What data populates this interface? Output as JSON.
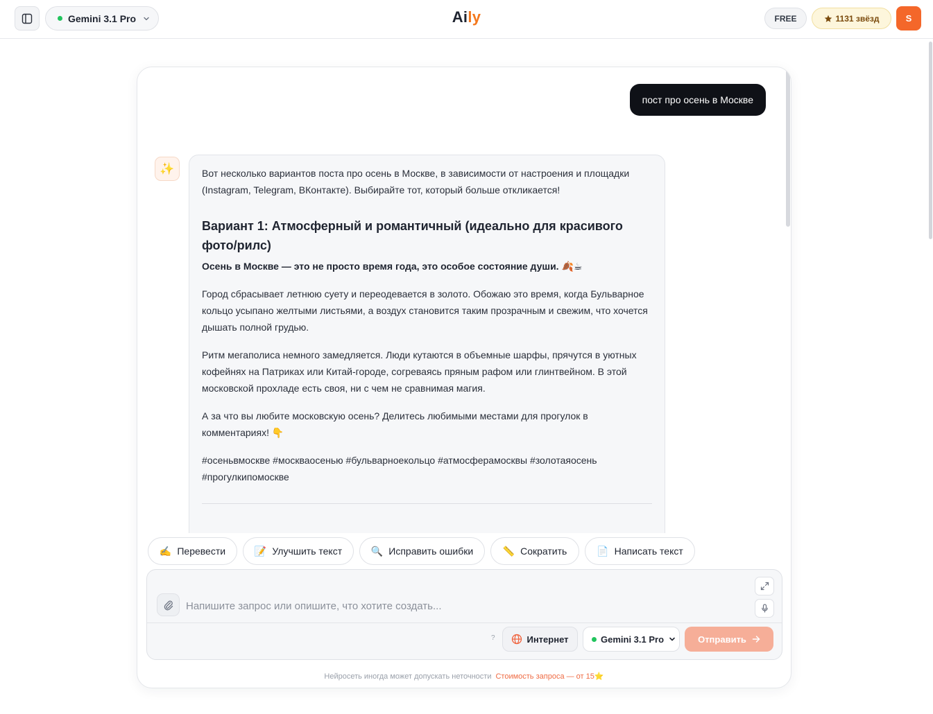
{
  "header": {
    "model_name": "Gemini 3.1 Pro",
    "logo_part1": "Ai",
    "logo_part2": "ly",
    "plan_badge": "FREE",
    "stars_label": "1131 звёзд",
    "avatar_initial": "S",
    "colors": {
      "accent": "#f4781d",
      "avatar": "#f4672a",
      "status_online": "#21c45d"
    }
  },
  "chat": {
    "user_message": "пост про осень в Москве",
    "ai_avatar_icon": "sparkles-icon",
    "ai_avatar_glyph": "✨",
    "response": {
      "intro": "Вот несколько вариантов поста про осень в Москве, в зависимости от настроения и площадки (Instagram, Telegram, ВКонтакте). Выбирайте тот, который больше откликается!",
      "heading": "Вариант 1: Атмосферный и романтичный (идеально для красивого фото/рилс)",
      "lead": "Осень в Москве — это не просто время года, это особое состояние души. 🍂☕",
      "p1": "Город сбрасывает летнюю суету и переодевается в золото. Обожаю это время, когда Бульварное кольцо усыпано желтыми листьями, а воздух становится таким прозрачным и свежим, что хочется дышать полной грудью.",
      "p2": "Ритм мегаполиса немного замедляется. Люди кутаются в объемные шарфы, прячутся в уютных кофейнях на Патриках или Китай-городе, согреваясь пряным рафом или глинтвейном. В этой московской прохладе есть своя, ни с чем не сравнимая магия.",
      "p3": "А за что вы любите московскую осень? Делитесь любимыми местами для прогулок в комментариях! 👇",
      "hashtags": "#осеньвмоскве #москваосенью #бульварноекольцо #атмосферамосквы #золотаяосень #прогулкипомоскве"
    }
  },
  "quick_actions": [
    {
      "emoji": "✍️",
      "label": "Перевести"
    },
    {
      "emoji": "📝",
      "label": "Улучшить текст"
    },
    {
      "emoji": "🔍",
      "label": "Исправить ошибки"
    },
    {
      "emoji": "📏",
      "label": "Сократить"
    },
    {
      "emoji": "📄",
      "label": "Написать текст"
    }
  ],
  "composer": {
    "placeholder": "Напишите запрос или опишите, что хотите создать...",
    "value": "",
    "help_mark": "?",
    "internet_label": "Интернет",
    "model_label": "Gemini 3.1 Pro",
    "send_label": "Отправить",
    "send_color": "#f6ae98"
  },
  "footer": {
    "disclaimer": "Нейросеть иногда может допускать неточности",
    "cost": "Стоимость запроса — от 15⭐"
  }
}
